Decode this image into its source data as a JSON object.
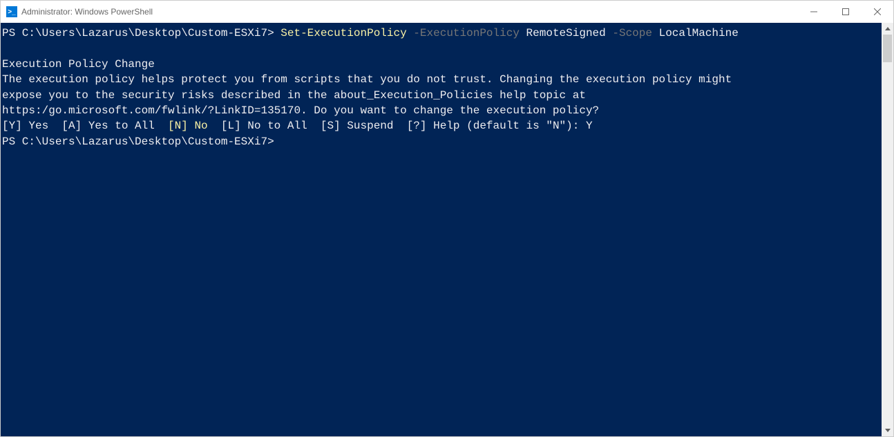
{
  "window": {
    "title": "Administrator: Windows PowerShell",
    "icon_glyph": ">_"
  },
  "terminal": {
    "lines": {
      "l1_prompt": "PS C:\\Users\\Lazarus\\Desktop\\Custom-ESXi7> ",
      "l1_cmd": "Set-ExecutionPolicy",
      "l1_p1": " -ExecutionPolicy",
      "l1_v1": " RemoteSigned",
      "l1_p2": " -Scope",
      "l1_v2": " LocalMachine",
      "l2_blank": "",
      "l3": "Execution Policy Change",
      "l4": "The execution policy helps protect you from scripts that you do not trust. Changing the execution policy might",
      "l5": "expose you to the security risks described in the about_Execution_Policies help topic at",
      "l6": "https:/go.microsoft.com/fwlink/?LinkID=135170. Do you want to change the execution policy?",
      "l7_a": "[Y] Yes  [A] Yes to All  ",
      "l7_b": "[N] No",
      "l7_c": "  [L] No to All  [S] Suspend  [?] Help (default is \"N\"): Y",
      "l8": "PS C:\\Users\\Lazarus\\Desktop\\Custom-ESXi7>"
    }
  }
}
